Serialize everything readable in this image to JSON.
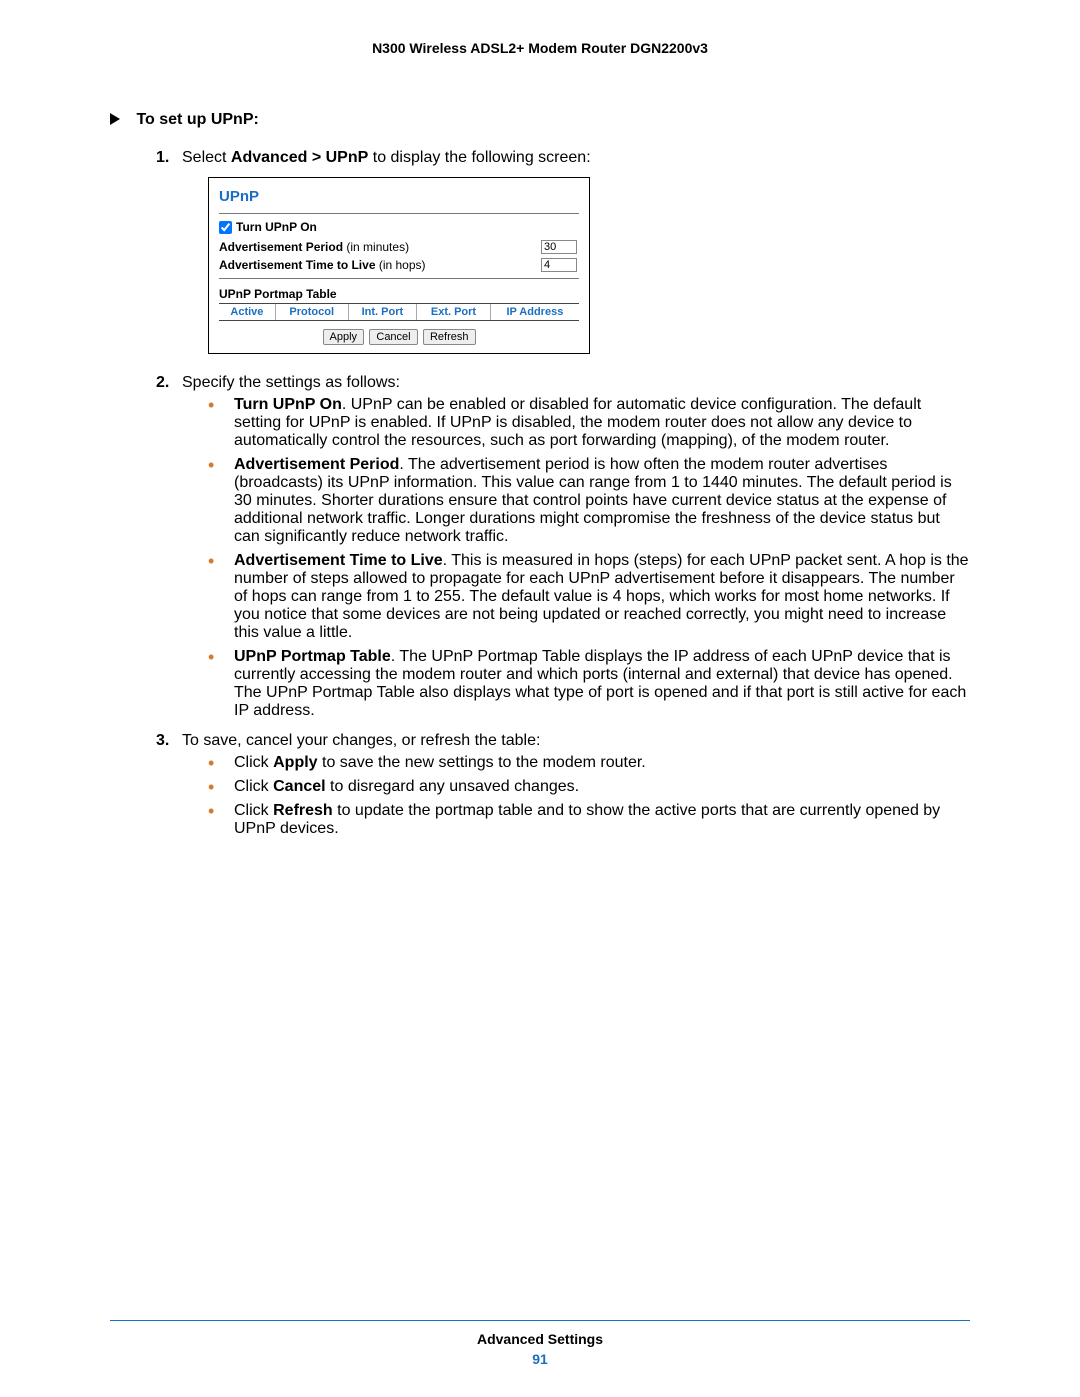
{
  "header": {
    "title": "N300 Wireless ADSL2+ Modem Router DGN2200v3"
  },
  "procedure": {
    "title": "To set up UPnP:"
  },
  "step1": {
    "num": "1.",
    "pre": "Select ",
    "bold": "Advanced > UPnP",
    "post": " to display the following screen:"
  },
  "figure": {
    "panelTitle": "UPnP",
    "turnOnLabel": "Turn UPnP On",
    "advPeriodLabel": "Advertisement Period",
    "advPeriodUnit": " (in minutes)",
    "advPeriodVal": "30",
    "ttlLabel": "Advertisement Time to Live",
    "ttlUnit": " (in hops)",
    "ttlVal": "4",
    "portmapTitle": "UPnP Portmap Table",
    "cols": {
      "c1": "Active",
      "c2": "Protocol",
      "c3": "Int. Port",
      "c4": "Ext. Port",
      "c5": "IP Address"
    },
    "btnApply": "Apply",
    "btnCancel": "Cancel",
    "btnRefresh": "Refresh"
  },
  "step2": {
    "num": "2.",
    "text": "Specify the settings as follows:"
  },
  "b1": {
    "title": "Turn UPnP On",
    "text": ". UPnP can be enabled or disabled for automatic device configuration. The default setting for UPnP is enabled. If UPnP is disabled, the modem router does not allow any device to automatically control the resources, such as port forwarding (mapping), of the modem router."
  },
  "b2": {
    "title": "Advertisement Period",
    "text": ". The advertisement period is how often the modem router advertises (broadcasts) its UPnP information. This value can range from 1 to 1440 minutes. The default period is 30 minutes. Shorter durations ensure that control points have current device status at the expense of additional network traffic. Longer durations might compromise the freshness of the device status but can significantly reduce network traffic."
  },
  "b3": {
    "title": "Advertisement Time to Live",
    "text": ". This is measured in hops (steps) for each UPnP packet sent. A hop is the number of steps allowed to propagate for each UPnP advertisement before it disappears. The number of hops can range from 1 to 255. The default value is 4 hops, which works for most home networks. If you notice that some devices are not being updated or reached correctly, you might need to increase this value a little."
  },
  "b4": {
    "title": "UPnP Portmap Table",
    "text": ". The UPnP Portmap Table displays the IP address of each UPnP device that is currently accessing the modem router and which ports (internal and external) that device has opened. The UPnP Portmap Table also displays what type of port is opened and if that port is still active for each IP address."
  },
  "step3": {
    "num": "3.",
    "text": "To save, cancel your changes, or refresh the table:"
  },
  "s3a": {
    "pre": "Click ",
    "bold": "Apply",
    "post": " to save the new settings to the modem router."
  },
  "s3b": {
    "pre": "Click ",
    "bold": "Cancel",
    "post": " to disregard any unsaved changes."
  },
  "s3c": {
    "pre": "Click ",
    "bold": "Refresh",
    "post": " to update the portmap table and to show the active ports that are currently opened by UPnP devices."
  },
  "footer": {
    "section": "Advanced Settings",
    "page": "91"
  }
}
